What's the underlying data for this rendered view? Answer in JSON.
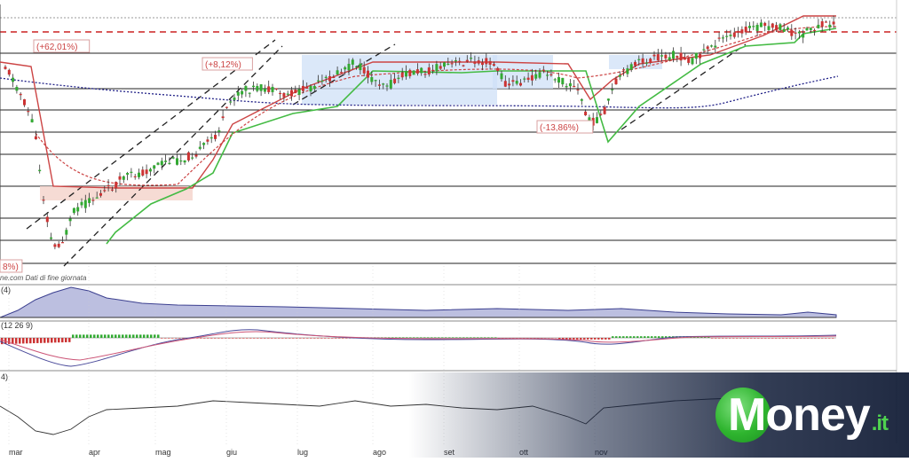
{
  "chart_data": [
    {
      "type": "candlestick",
      "panel": "price",
      "note_source": "ne.com  Dati di fine giornata",
      "annotations": [
        "(+62,01%)",
        "(+8,12%)",
        "(-13,86%)",
        "8%)"
      ],
      "months": [
        "mar",
        "apr",
        "mag",
        "giu",
        "lug",
        "ago",
        "set",
        "ott",
        "nov"
      ],
      "colors": {
        "up": "#33aa33",
        "down": "#cc3333",
        "resistance": "#cc2222",
        "ma_long": "#222288",
        "ma_short": "#cc4444",
        "trail_up": "#44bb44",
        "trail_down": "#cc4444"
      }
    },
    {
      "type": "area",
      "panel": "indicator-1",
      "label": "(4)"
    },
    {
      "type": "histogram",
      "panel": "macd",
      "label": "(12 26 9)"
    },
    {
      "type": "line",
      "panel": "indicator-3",
      "label": "4)"
    }
  ],
  "brand": {
    "name": "Money",
    "suffix": ".it"
  }
}
